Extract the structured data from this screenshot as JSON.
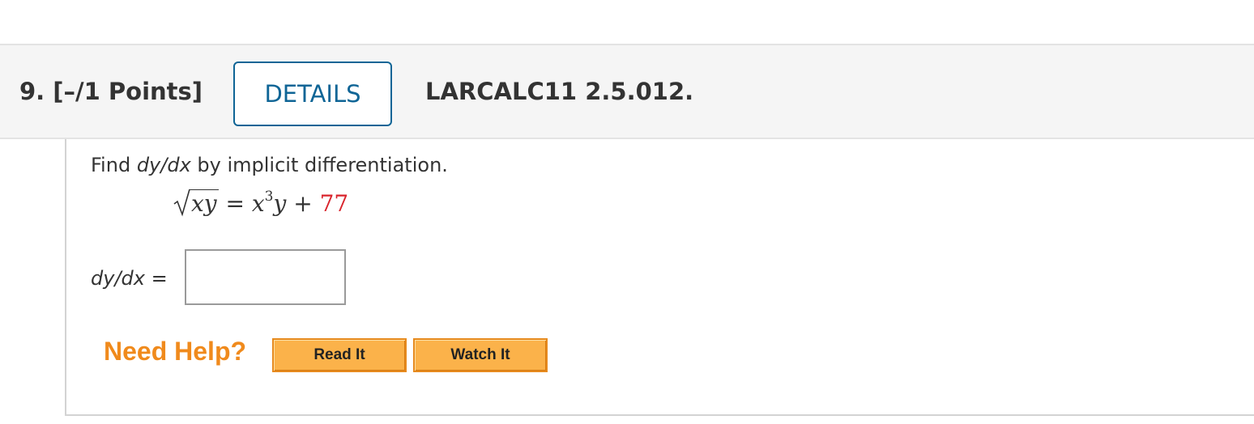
{
  "question": {
    "number_points": "9.  [–/1 Points]",
    "details_label": "DETAILS",
    "code": "LARCALC11 2.5.012."
  },
  "problem": {
    "prompt_prefix": "Find ",
    "prompt_derivative": "dy/dx",
    "prompt_suffix": " by implicit differentiation.",
    "equation": {
      "radicand": "xy",
      "equals": " = ",
      "term_base": "x",
      "term_exponent": "3",
      "term_var": "y",
      "plus": " + ",
      "constant": "77",
      "constant_color": "#d9232b"
    }
  },
  "answer": {
    "label_derivative": "dy/dx",
    "label_equals": " =",
    "input_value": "",
    "input_placeholder": ""
  },
  "help": {
    "label": "Need Help?",
    "read_label": "Read It",
    "watch_label": "Watch It"
  },
  "colors": {
    "accent_blue": "#0f6596",
    "help_orange": "#f08a1c",
    "button_orange": "#fbb24a",
    "header_gray": "#f5f5f5"
  }
}
